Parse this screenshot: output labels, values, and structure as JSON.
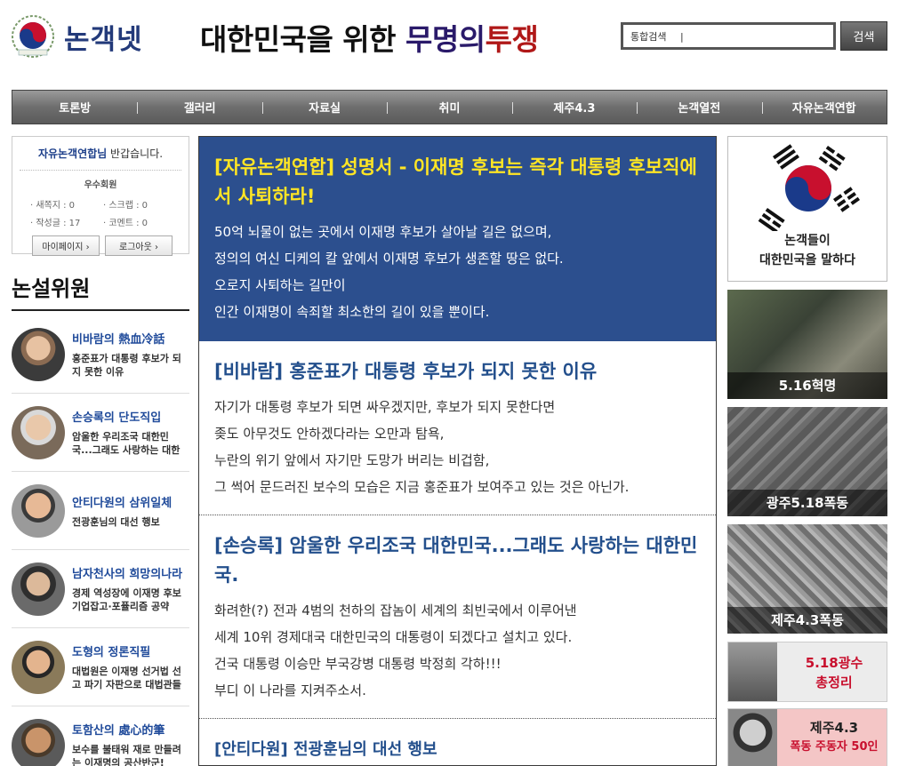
{
  "header": {
    "logo_text": "논객넷",
    "slogan_part1": "대한민국을 위한",
    "slogan_part2": "무명의",
    "slogan_part3": "투쟁",
    "search_value": "통합검색",
    "search_button": "검색"
  },
  "nav": [
    "토론방",
    "갤러리",
    "자료실",
    "취미",
    "제주4.3",
    "논객열전",
    "자유논객연합"
  ],
  "member": {
    "name": "자유논객연합님",
    "greeting": "반갑습니다.",
    "grade": "우수회원",
    "stats": [
      "· 새쪽지 : 0",
      "· 스크랩 : 0",
      "· 작성글 : 17",
      "· 코멘트 : 0"
    ],
    "mypage": "마이페이지 ›",
    "logout": "로그아웃 ›"
  },
  "sidebar": {
    "title": "논설위원",
    "writers": [
      {
        "name": "비바람의 熱血冷話",
        "desc": [
          "홍준표가 대통령 후보가 되",
          "지 못한 이유"
        ]
      },
      {
        "name": "손승록의 단도직입",
        "desc": [
          "암울한 우리조국 대한민",
          "국...그래도 사랑하는 대한"
        ]
      },
      {
        "name": "안티다원의 삼위일체",
        "desc": [
          "전광훈님의 대선 행보",
          ""
        ]
      },
      {
        "name": "남자천사의 희망의나라",
        "desc": [
          "경제 역성장에 이재명 후보",
          "기업잡고·포퓰리즘 공약"
        ]
      },
      {
        "name": "도형의 정론직필",
        "desc": [
          "대법원은 이재명 선거법 선",
          "고 파기 자판으로 대법관들"
        ]
      },
      {
        "name": "토함산의 處心的筆",
        "desc": [
          "보수를 불태워 재로 만들려",
          "는 이재명의 공산반군!"
        ]
      }
    ]
  },
  "articles": [
    {
      "title": "[자유논객연합] 성명서 - 이재명 후보는 즉각 대통령 후보직에서 사퇴하라!",
      "lines": [
        "50억 뇌물이 없는 곳에서 이재명 후보가 살아날 길은 없으며,",
        "정의의 여신 디케의 칼 앞에서 이재명 후보가 생존할 땅은 없다.",
        "오로지 사퇴하는 길만이",
        "인간 이재명이 속죄할 최소한의 길이 있을 뿐이다."
      ]
    },
    {
      "title": "[비바람] 홍준표가 대통령 후보가 되지 못한 이유",
      "lines": [
        "자기가 대통령 후보가 되면 싸우겠지만, 후보가 되지 못한다면",
        "좆도 아무것도 안하겠다라는 오만과 탐욕,",
        "누란의 위기 앞에서 자기만 도망가 버리는 비겁함,",
        "그 썩어 문드러진 보수의 모습은 지금 홍준표가 보여주고 있는 것은 아닌가."
      ]
    },
    {
      "title": "[손승록] 암울한 우리조국 대한민국...그래도 사랑하는 대한민국.",
      "lines": [
        "화려한(?) 전과 4범의 천하의 잡놈이 세계의 최빈국에서 이루어낸",
        "세계 10위 경제대국 대한민국의 대통령이 되겠다고 설치고 있다.",
        "건국 대통령 이승만 부국강병 대통령 박정희 각하!!!",
        "부디 이 나라를 지켜주소서."
      ]
    },
    {
      "title": "[안티다원] 전광훈님의 대선 행보",
      "lines": []
    }
  ],
  "right": {
    "promo_line1": "논객들이",
    "promo_line2": "대한민국을 말하다",
    "banners": [
      "5.16혁명",
      "광주5.18폭동",
      "제주4.3폭동"
    ],
    "ad1_line1": "5.18광수",
    "ad1_line2": "총정리",
    "ad2_line1": "제주4.3",
    "ad2_line2": "폭동 주동자 50인"
  },
  "colors": {
    "featured_bg": "#2c4f8e",
    "featured_title": "#ffe524",
    "article_title": "#234f8c",
    "writer_name": "#1f4a9a",
    "slogan_red": "#b01818"
  }
}
